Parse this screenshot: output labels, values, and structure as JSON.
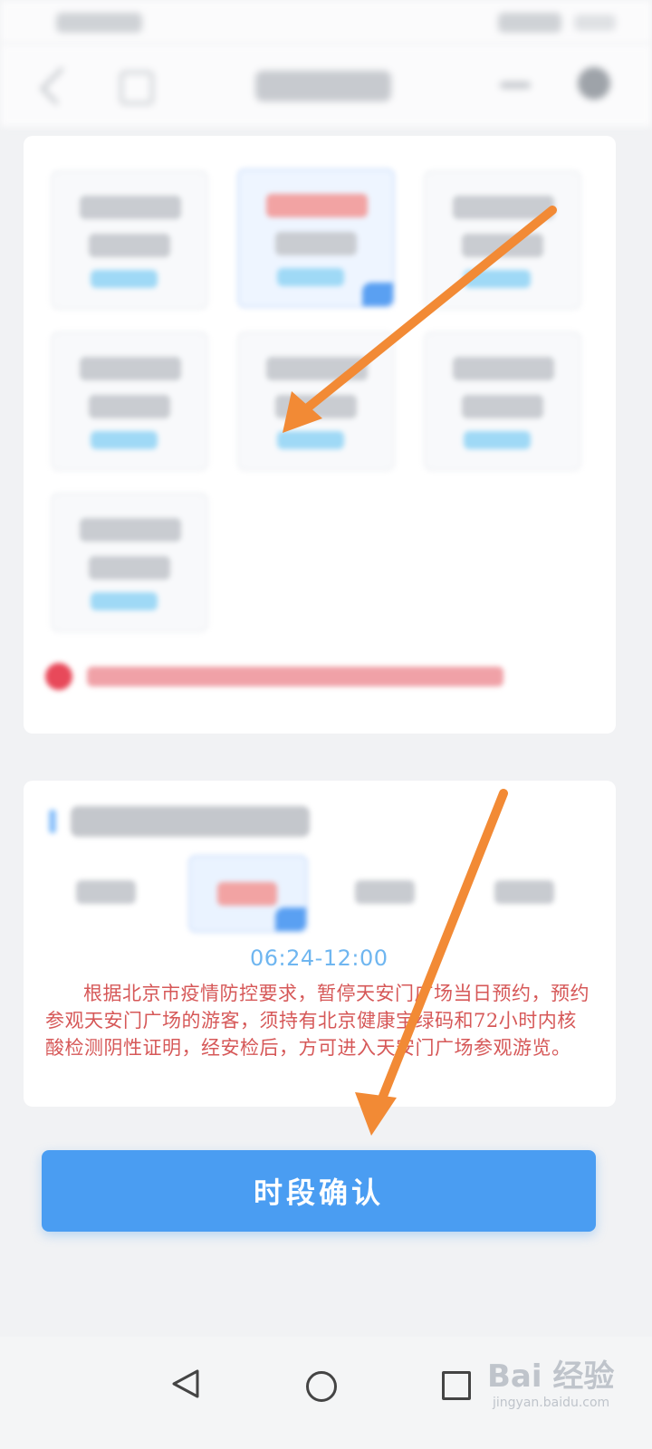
{
  "period_detail": {
    "time_range": "06:24-12:00",
    "notice": "根据北京市疫情防控要求，暂停天安门广场当日预约，预约参观天安门广场的游客，须持有北京健康宝绿码和72小时内核酸检测阴性证明，经安检后，方可进入天安门广场参观游览。"
  },
  "confirm_button": {
    "label": "时段确认"
  },
  "watermark": {
    "brand": "Bai 经验",
    "domain": "jingyan.baidu.com"
  },
  "colors": {
    "accent": "#4a9df2",
    "arrow": "#f28a35",
    "notice_text": "#d65858",
    "time_text": "#6fb6f0"
  },
  "icons": {
    "nav_back": "triangle-back-icon",
    "nav_home": "circle-home-icon",
    "nav_recent": "square-recent-icon"
  }
}
